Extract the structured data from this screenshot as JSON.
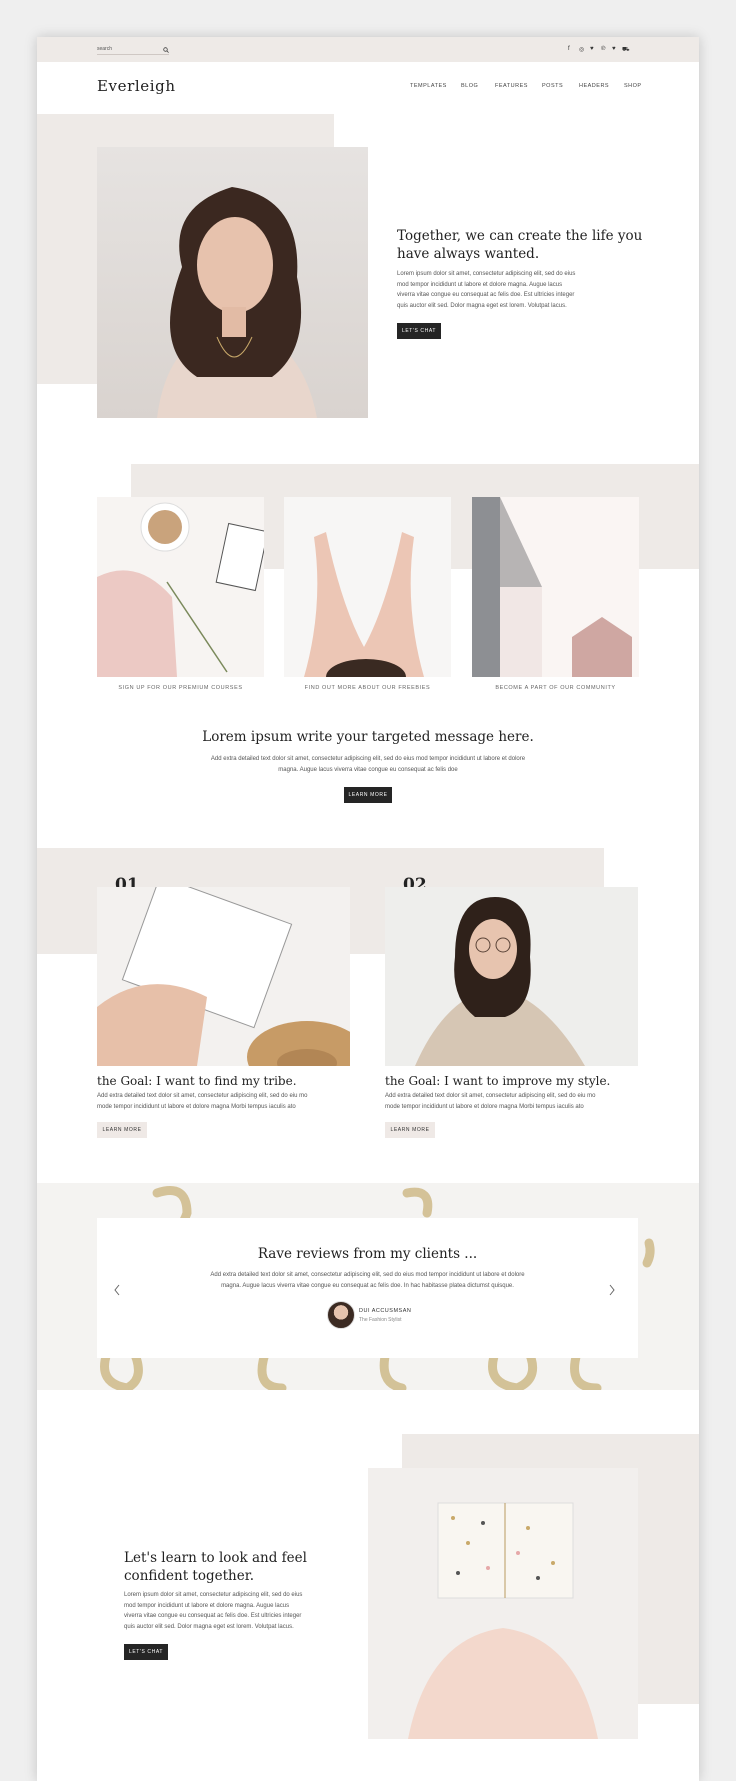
{
  "topbar": {
    "search_label": "search",
    "social_icons": [
      "facebook-icon",
      "instagram-icon",
      "twitter-icon",
      "pinterest-icon",
      "heart-icon",
      "cart-icon"
    ]
  },
  "header": {
    "logo": "Everleigh",
    "nav": [
      "TEMPLATES",
      "BLOG",
      "FEATURES",
      "POSTS",
      "HEADERS",
      "SHOP"
    ]
  },
  "hero": {
    "heading_line1": "Together, we can create the life you",
    "heading_line2": "have always wanted.",
    "body_lines": [
      "Lorem ipsum dolor sit amet, consectetur adipiscing elit, sed do eius",
      "mod tempor incididunt ut labore et dolore magna. Augue lacus",
      "viverra vitae congue eu consequat ac felis doe. Est ultricies integer",
      "quis auctor elit sed. Dolor magna eget est lorem. Volutpat lacus."
    ],
    "button": "LET'S CHAT"
  },
  "tiles": [
    {
      "caption": "SIGN UP FOR OUR PREMIUM COURSES"
    },
    {
      "caption": "FIND OUT MORE ABOUT OUR FREEBIES"
    },
    {
      "caption": "BECOME A PART OF OUR COMMUNITY"
    }
  ],
  "message": {
    "heading": "Lorem ipsum write your targeted message here.",
    "line1": "Add extra detailed text dolor sit amet, consectetur adipiscing elit, sed do eius mod tempor incididunt ut labore et dolore",
    "line2": "magna. Augue lacus viverra vitae congue eu consequat ac felis doe",
    "button": "LEARN MORE"
  },
  "goals": [
    {
      "number": "01",
      "title": "the Goal: I want to find my tribe.",
      "line1": "Add extra detailed text dolor sit amet, consectetur adipiscing elit, sed do eiu mo",
      "line2": "mode tempor incididunt ut labore et dolore magna Morbi tempus iaculis ato",
      "button": "LEARN MORE"
    },
    {
      "number": "02",
      "title": "the Goal: I want to improve my style.",
      "line1": "Add extra detailed text dolor sit amet, consectetur adipiscing elit, sed do eiu mo",
      "line2": "mode tempor incididunt ut labore et dolore magna Morbi tempus iaculis ato",
      "button": "LEARN MORE"
    }
  ],
  "reviews": {
    "heading": "Rave reviews from my clients ...",
    "line1": "Add extra detailed text dolor sit amet, consectetur adipiscing elit, sed do eius mod tempor incididunt ut labore et dolore",
    "line2": "magna. Augue lacus viverra vitae congue eu consequat ac felis doe. In hac habitasse platea dictumst quisque.",
    "reviewer_name": "DUI ACCUSMSAN",
    "reviewer_role": "The Fashion Stylist"
  },
  "closing": {
    "heading_line1": "Let's learn to look and feel",
    "heading_line2": "confident together.",
    "body_lines": [
      "Lorem ipsum dolor sit amet, consectetur adipiscing elit, sed do eius",
      "mod tempor incididunt ut labore et dolore magna. Augue lacus",
      "viverra vitae congue eu consequat ac felis doe. Est ultricies integer",
      "quis auctor elit sed. Dolor magna eget est lorem. Volutpat lacus."
    ],
    "button": "LET'S CHAT"
  },
  "colors": {
    "accent_beige": "#eeeae7",
    "button_dark": "#252525",
    "gold": "#c9b27a"
  }
}
